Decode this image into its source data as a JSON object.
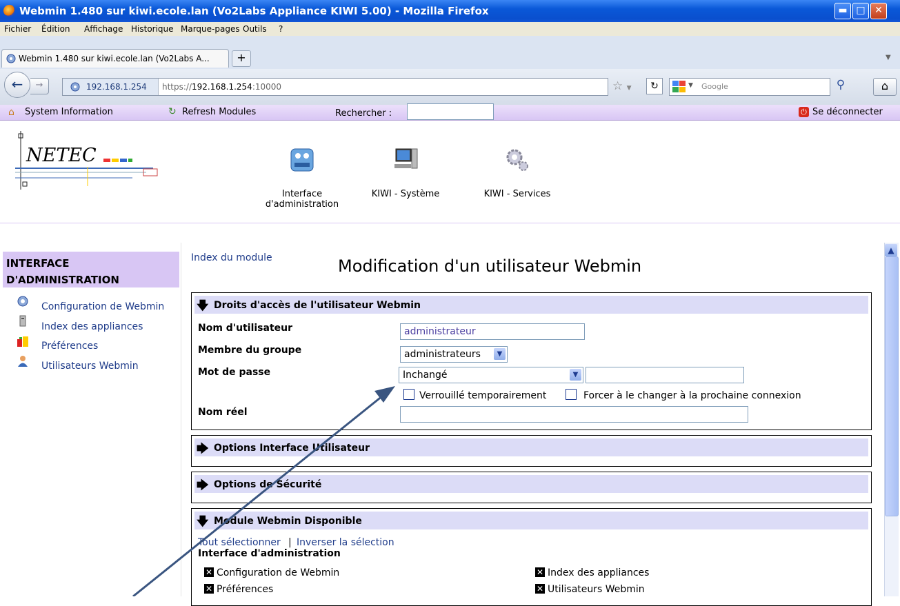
{
  "window": {
    "title": "Webmin 1.480 sur kiwi.ecole.lan (Vo2Labs Appliance KIWI 5.00) - Mozilla Firefox"
  },
  "menu": [
    "Fichier",
    "Édition",
    "Affichage",
    "Historique",
    "Marque-pages",
    "Outils",
    "?"
  ],
  "tab": {
    "label": "Webmin 1.480 sur kiwi.ecole.lan (Vo2Labs A...",
    "new": "+"
  },
  "nav": {
    "identity": "192.168.1.254",
    "url_scheme": "https://",
    "url_host": "192.168.1.254",
    "url_port": ":10000",
    "search_placeholder": "Google"
  },
  "webmin_bar": {
    "system_info": "System Information",
    "refresh": "Refresh Modules",
    "search_label": "Rechercher :",
    "logout": "Se déconnecter"
  },
  "logo": {
    "text": "NETEC"
  },
  "modules": [
    {
      "label": "Interface",
      "label2": "d'administration"
    },
    {
      "label": "KIWI - Système"
    },
    {
      "label": "KIWI - Services"
    }
  ],
  "sidebar": {
    "title1": "INTERFACE",
    "title2": "D'ADMINISTRATION",
    "items": [
      "Configuration de Webmin",
      "Index des appliances",
      "Préférences",
      "Utilisateurs Webmin"
    ]
  },
  "main": {
    "index_link": "Index du module",
    "title": "Modification d'un utilisateur Webmin",
    "sec1": {
      "title": "Droits d'accès de l'utilisateur Webmin",
      "username_label": "Nom d'utilisateur",
      "username_value": "administrateur",
      "group_label": "Membre du groupe",
      "group_value": "administrateurs",
      "password_label": "Mot de passe",
      "password_mode": "Inchangé",
      "locked_label": "Verrouillé temporairement",
      "force_label": "Forcer à le changer à la prochaine connexion",
      "realname_label": "Nom réel"
    },
    "sec2": {
      "title": "Options Interface Utilisateur"
    },
    "sec3": {
      "title": "Options de Sécurité"
    },
    "sec4": {
      "title": "Module Webmin Disponible",
      "select_all": "Tout sélectionner",
      "sep": "|",
      "invert": "Inverser la sélection",
      "category": "Interface d'administration",
      "modules": [
        "Configuration de Webmin",
        "Index des appliances",
        "Préférences",
        "Utilisateurs Webmin"
      ]
    }
  },
  "colors": {
    "titlebar": "#0a58d8",
    "webmin_bar": "#d8c6f4",
    "section_head": "#dcdcf7",
    "link": "#1f3c8a"
  }
}
